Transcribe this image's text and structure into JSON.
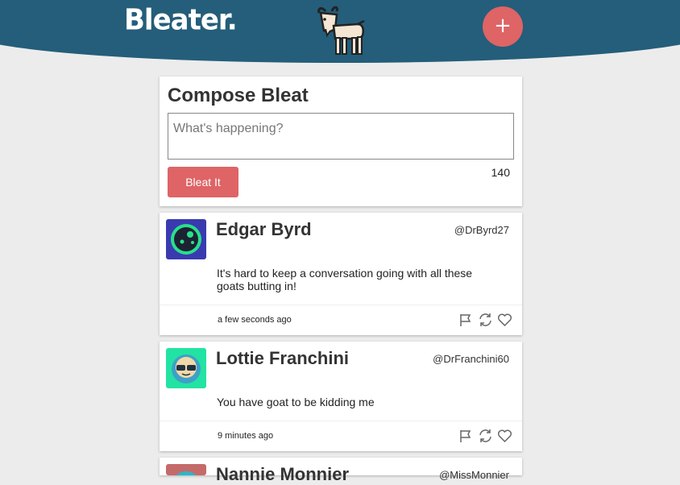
{
  "header": {
    "logo": "Bleater.",
    "goat_icon": "goat-icon",
    "add_button_label": "+",
    "accent_color": "#de6466",
    "bar_color": "#245e7a"
  },
  "compose": {
    "title": "Compose Bleat",
    "placeholder": "What's happening?",
    "value": "",
    "char_count": "140",
    "submit_label": "Bleat It"
  },
  "posts": [
    {
      "name": "Edgar Byrd",
      "handle": "@DrByrd27",
      "text": "It's hard to keep a conversation going with all these goats butting in!",
      "time": "a few seconds ago",
      "avatar_icon": "alien-face-avatar-icon",
      "actions": [
        "flag-icon",
        "rebleat-icon",
        "heart-icon"
      ]
    },
    {
      "name": "Lottie Franchini",
      "handle": "@DrFranchini60",
      "text": "You have goat to be kidding me",
      "time": "9 minutes ago",
      "avatar_icon": "sunglasses-face-avatar-icon",
      "actions": [
        "flag-icon",
        "rebleat-icon",
        "heart-icon"
      ]
    },
    {
      "name": "Nannie Monnier",
      "handle": "@MissMonnier",
      "avatar_icon": "face-avatar-icon"
    }
  ]
}
